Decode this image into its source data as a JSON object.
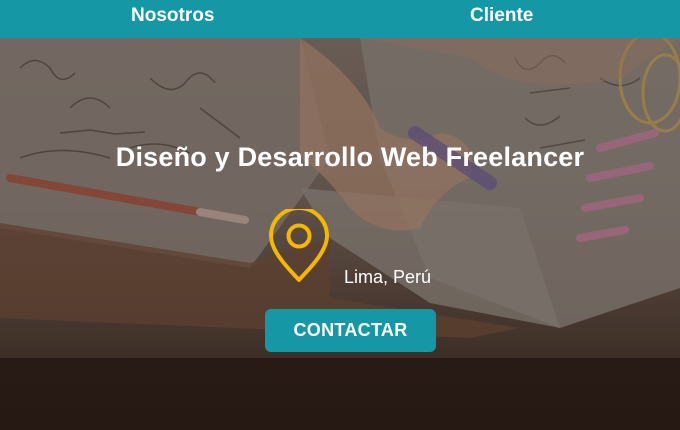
{
  "nav": {
    "items": [
      {
        "label": "Nosotros"
      },
      {
        "label": "Cliente"
      }
    ]
  },
  "hero": {
    "title": "Diseño y Desarrollo Web Freelancer",
    "location": "Lima, Perú",
    "cta_label": "CONTACTAR",
    "location_icon": "map-pin-icon"
  },
  "colors": {
    "brand": "#1597a6",
    "pin": "#f5b700",
    "text": "#ffffff"
  }
}
